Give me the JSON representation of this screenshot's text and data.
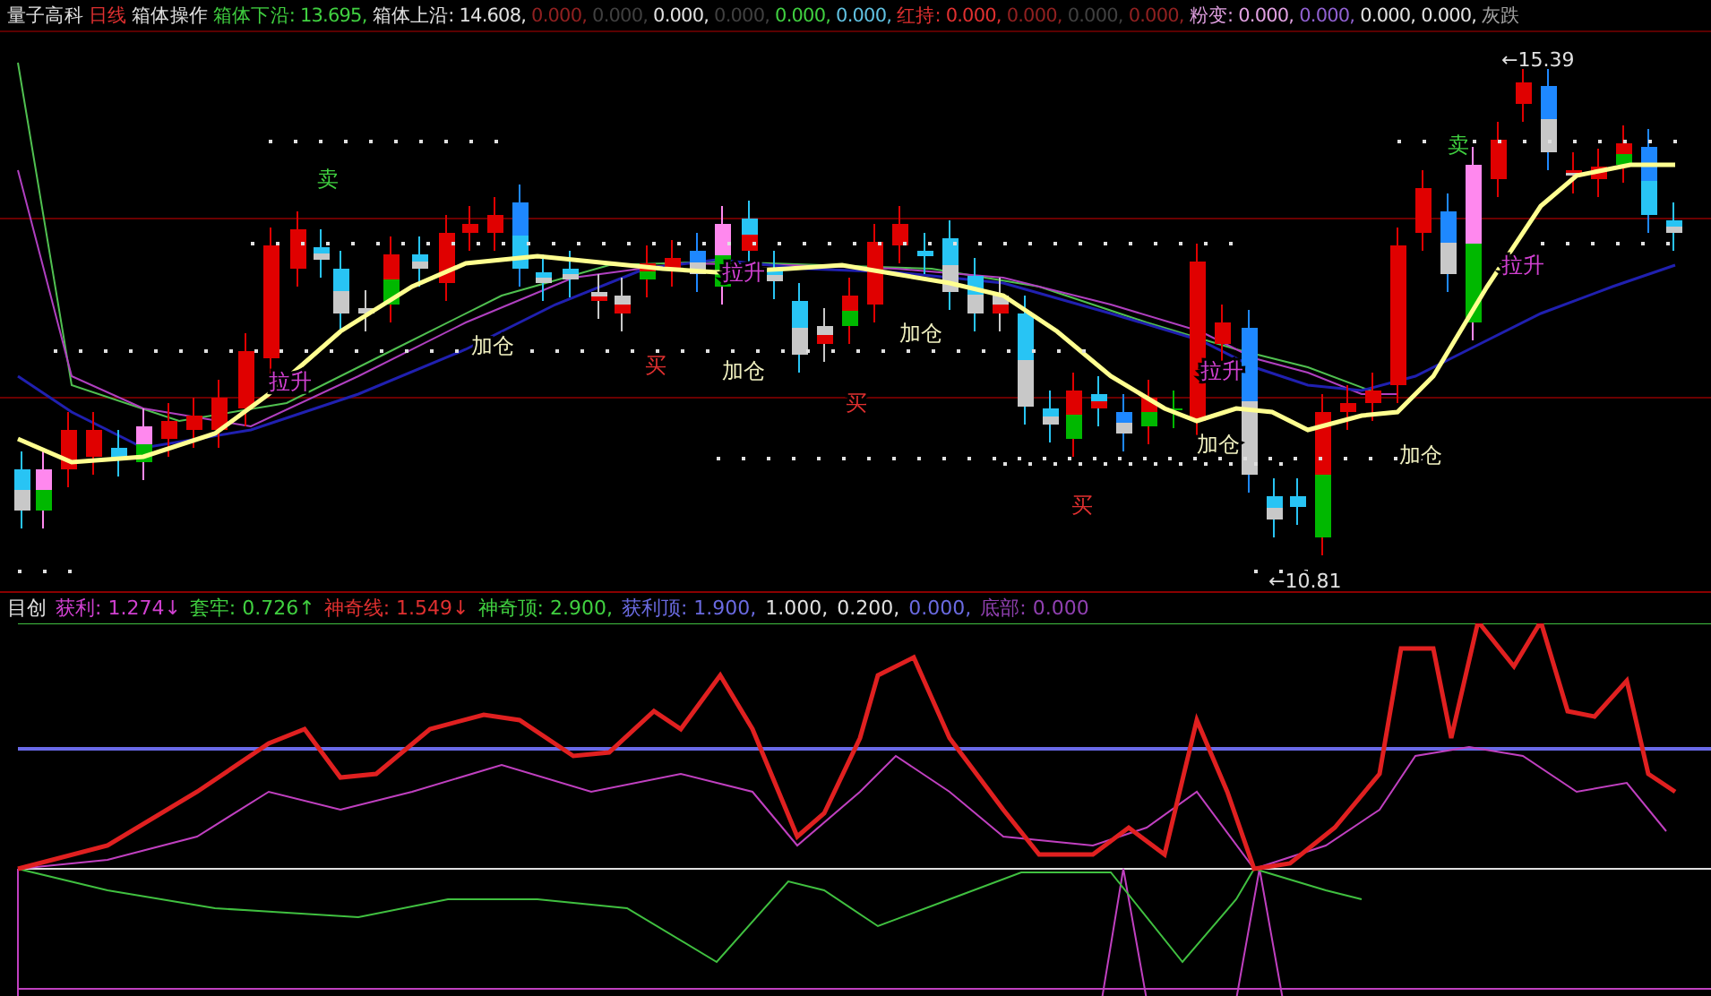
{
  "header": [
    {
      "text": "量子高科",
      "color": "#e0e0e0"
    },
    {
      "text": "日线",
      "color": "#e03030"
    },
    {
      "text": "箱体操作",
      "color": "#e0e0e0"
    },
    {
      "text": "箱体下沿: 13.695,",
      "color": "#40d040"
    },
    {
      "text": "箱体上沿: 14.608,",
      "color": "#e0e0e0"
    },
    {
      "text": "0.000,",
      "color": "#902020"
    },
    {
      "text": "0.000,",
      "color": "#404040"
    },
    {
      "text": "0.000,",
      "color": "#e0e0e0"
    },
    {
      "text": "0.000,",
      "color": "#404040"
    },
    {
      "text": "0.000,",
      "color": "#40d040"
    },
    {
      "text": "0.000,",
      "color": "#60c0e0"
    },
    {
      "text": "红持: 0.000,",
      "color": "#e03030"
    },
    {
      "text": "0.000,",
      "color": "#902020"
    },
    {
      "text": "0.000,",
      "color": "#404040"
    },
    {
      "text": "0.000,",
      "color": "#902020"
    },
    {
      "text": "粉变: 0.000,",
      "color": "#e0a0e0"
    },
    {
      "text": "0.000,",
      "color": "#9060d0"
    },
    {
      "text": "0.000,",
      "color": "#e0e0e0"
    },
    {
      "text": "0.000,",
      "color": "#e0e0e0"
    },
    {
      "text": "灰跌",
      "color": "#a0a0a0"
    }
  ],
  "signals": [
    {
      "kind": "sell",
      "text": "卖"
    },
    {
      "kind": "rise",
      "text": "拉升"
    },
    {
      "kind": "add",
      "text": "加仓"
    },
    {
      "kind": "buy",
      "text": "买"
    },
    {
      "kind": "rise",
      "text": "拉升"
    },
    {
      "kind": "add",
      "text": "加仓"
    },
    {
      "kind": "buy",
      "text": "买"
    },
    {
      "kind": "add",
      "text": "加仓"
    },
    {
      "kind": "buy",
      "text": "买"
    },
    {
      "kind": "rise",
      "text": "拉升"
    },
    {
      "kind": "add",
      "text": "加仓"
    },
    {
      "kind": "low",
      "text": "←10.81"
    },
    {
      "kind": "add",
      "text": "加仓"
    },
    {
      "kind": "sell",
      "text": "卖"
    },
    {
      "kind": "rise",
      "text": "拉升"
    },
    {
      "kind": "high",
      "text": "←15.39"
    }
  ],
  "indicator_header": [
    {
      "text": "目创",
      "color": "#e0e0e0"
    },
    {
      "text": "获利: 1.274↓",
      "color": "#d040d0"
    },
    {
      "text": "套牢: 0.726↑",
      "color": "#40d040"
    },
    {
      "text": "神奇线: 1.549↓",
      "color": "#e03030"
    },
    {
      "text": "神奇顶: 2.900,",
      "color": "#40d040"
    },
    {
      "text": "获利顶: 1.900,",
      "color": "#6a6ae0"
    },
    {
      "text": "1.000,",
      "color": "#e0e0e0"
    },
    {
      "text": "0.200,",
      "color": "#e0e0e0"
    },
    {
      "text": "0.000,",
      "color": "#6a6ae0"
    },
    {
      "text": "底部: 0.000",
      "color": "#9040b0"
    }
  ]
}
